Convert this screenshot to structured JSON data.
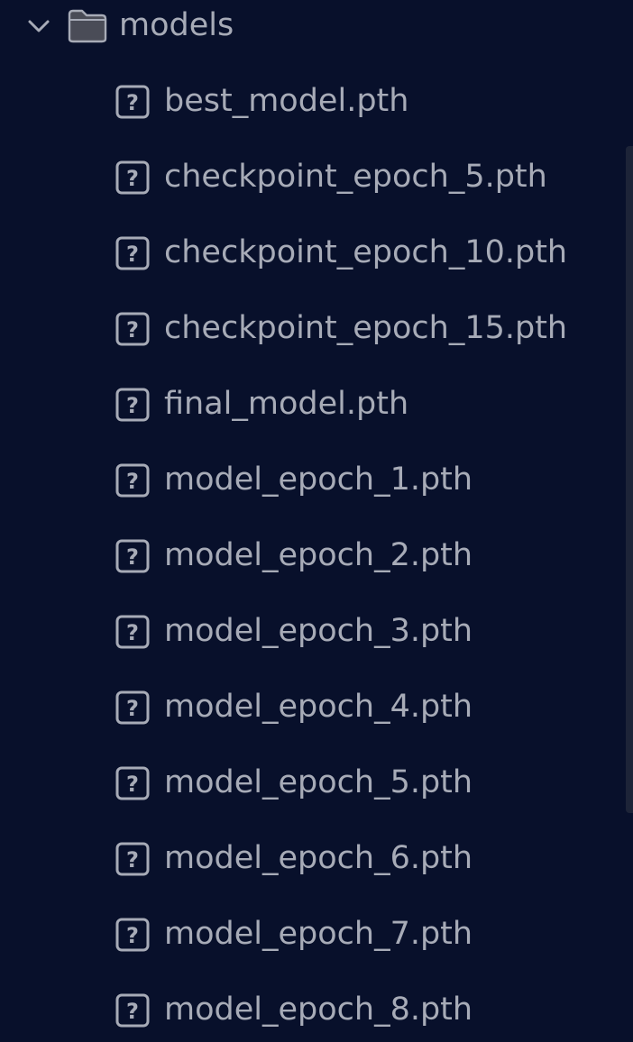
{
  "explorer": {
    "folder": {
      "name": "models",
      "expanded": true,
      "chevron_icon": "chevron-down-icon",
      "folder_icon": "folder-icon"
    },
    "files": [
      {
        "name": "best_model.pth",
        "icon": "unknown-file-icon"
      },
      {
        "name": "checkpoint_epoch_5.pth",
        "icon": "unknown-file-icon"
      },
      {
        "name": "checkpoint_epoch_10.pth",
        "icon": "unknown-file-icon"
      },
      {
        "name": "checkpoint_epoch_15.pth",
        "icon": "unknown-file-icon"
      },
      {
        "name": "final_model.pth",
        "icon": "unknown-file-icon"
      },
      {
        "name": "model_epoch_1.pth",
        "icon": "unknown-file-icon"
      },
      {
        "name": "model_epoch_2.pth",
        "icon": "unknown-file-icon"
      },
      {
        "name": "model_epoch_3.pth",
        "icon": "unknown-file-icon"
      },
      {
        "name": "model_epoch_4.pth",
        "icon": "unknown-file-icon"
      },
      {
        "name": "model_epoch_5.pth",
        "icon": "unknown-file-icon"
      },
      {
        "name": "model_epoch_6.pth",
        "icon": "unknown-file-icon"
      },
      {
        "name": "model_epoch_7.pth",
        "icon": "unknown-file-icon"
      },
      {
        "name": "model_epoch_8.pth",
        "icon": "unknown-file-icon"
      }
    ]
  },
  "colors": {
    "background": "#08102b",
    "text": "#a7abb7",
    "icon": "#a7abb7",
    "folder_fill": "#4a4c57",
    "scrollbar": "#1d2438"
  }
}
